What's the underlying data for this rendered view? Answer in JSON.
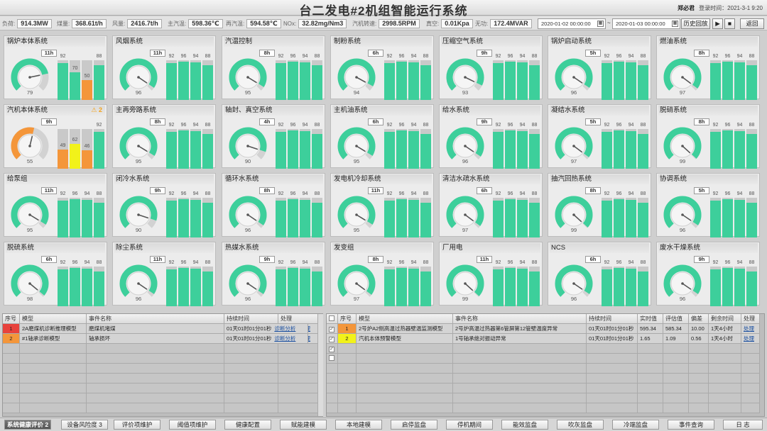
{
  "header": {
    "title": "台二发电#2机组智能运行系统",
    "user": "郑必君",
    "login_time": "登录时间：2021-3-1 9:20"
  },
  "metrics": [
    {
      "label": "负荷:",
      "value": "914.3MW"
    },
    {
      "label": "煤量:",
      "value": "368.61t/h"
    },
    {
      "label": "风量:",
      "value": "2416.7t/h"
    },
    {
      "label": "主汽温:",
      "value": "598.36℃"
    },
    {
      "label": "再汽温:",
      "value": "594.58℃"
    },
    {
      "label": "NOx:",
      "value": "32.82mg/Nm3"
    },
    {
      "label": "汽机转速:",
      "value": "2998.5RPM"
    },
    {
      "label": "真空:",
      "value": "0.01Kpa"
    },
    {
      "label": "无功:",
      "value": "172.4MVAR"
    }
  ],
  "history": {
    "start": "2020-01-02 00:00:00",
    "sep": "~",
    "end": "2020-01-03 00:00:00",
    "replay_label": "历史回放",
    "play_icon": "▶",
    "stop_icon": "■",
    "back_label": "返回"
  },
  "colors": {
    "ok": "#3dcf9b",
    "warn": "#f4963a",
    "alert": "#f2f21a",
    "track": "#c9c9c9"
  },
  "systems": [
    {
      "name": "锅炉本体系统",
      "hours": "11h",
      "score": 79,
      "status": "ok",
      "alarm": "",
      "bars": [
        92,
        70,
        50,
        88
      ],
      "bar_status": [
        "ok",
        "ok",
        "warn",
        "ok"
      ]
    },
    {
      "name": "风烟系统",
      "hours": "11h",
      "score": 96,
      "status": "ok",
      "alarm": "",
      "bars": [
        92,
        96,
        94,
        88
      ],
      "bar_status": [
        "ok",
        "ok",
        "ok",
        "ok"
      ]
    },
    {
      "name": "汽温控制",
      "hours": "8h",
      "score": 95,
      "status": "ok",
      "alarm": "",
      "bars": [
        92,
        96,
        94,
        88
      ],
      "bar_status": [
        "ok",
        "ok",
        "ok",
        "ok"
      ]
    },
    {
      "name": "制粉系统",
      "hours": "6h",
      "score": 94,
      "status": "ok",
      "alarm": "",
      "bars": [
        92,
        96,
        94,
        88
      ],
      "bar_status": [
        "ok",
        "ok",
        "ok",
        "ok"
      ]
    },
    {
      "name": "压缩空气系统",
      "hours": "9h",
      "score": 93,
      "status": "ok",
      "alarm": "",
      "bars": [
        92,
        96,
        94,
        88
      ],
      "bar_status": [
        "ok",
        "ok",
        "ok",
        "ok"
      ]
    },
    {
      "name": "锅炉启动系统",
      "hours": "5h",
      "score": 96,
      "status": "ok",
      "alarm": "",
      "bars": [
        92,
        96,
        94,
        88
      ],
      "bar_status": [
        "ok",
        "ok",
        "ok",
        "ok"
      ]
    },
    {
      "name": "燃油系统",
      "hours": "8h",
      "score": 97,
      "status": "ok",
      "alarm": "",
      "bars": [
        92,
        96,
        94,
        88
      ],
      "bar_status": [
        "ok",
        "ok",
        "ok",
        "ok"
      ]
    },
    {
      "name": "汽机本体系统",
      "hours": "9h",
      "score": 55,
      "status": "warn",
      "alarm": "⚠ 2",
      "bars": [
        49,
        62,
        46,
        92
      ],
      "bar_status": [
        "warn",
        "alert",
        "warn",
        "ok"
      ]
    },
    {
      "name": "主再旁路系统",
      "hours": "8h",
      "score": 95,
      "status": "ok",
      "alarm": "",
      "bars": [
        92,
        96,
        94,
        88
      ],
      "bar_status": [
        "ok",
        "ok",
        "ok",
        "ok"
      ]
    },
    {
      "name": "轴封、真空系统",
      "hours": "4h",
      "score": 90,
      "status": "ok",
      "alarm": "",
      "bars": [
        92,
        96,
        94,
        88
      ],
      "bar_status": [
        "ok",
        "ok",
        "ok",
        "ok"
      ]
    },
    {
      "name": "主机油系统",
      "hours": "6h",
      "score": 95,
      "status": "ok",
      "alarm": "",
      "bars": [
        92,
        96,
        94,
        88
      ],
      "bar_status": [
        "ok",
        "ok",
        "ok",
        "ok"
      ]
    },
    {
      "name": "给水系统",
      "hours": "9h",
      "score": 96,
      "status": "ok",
      "alarm": "",
      "bars": [
        92,
        96,
        94,
        88
      ],
      "bar_status": [
        "ok",
        "ok",
        "ok",
        "ok"
      ]
    },
    {
      "name": "凝结水系统",
      "hours": "5h",
      "score": 97,
      "status": "ok",
      "alarm": "",
      "bars": [
        92,
        96,
        94,
        88
      ],
      "bar_status": [
        "ok",
        "ok",
        "ok",
        "ok"
      ]
    },
    {
      "name": "脱硝系统",
      "hours": "8h",
      "score": 99,
      "status": "ok",
      "alarm": "",
      "bars": [
        92,
        96,
        94,
        88
      ],
      "bar_status": [
        "ok",
        "ok",
        "ok",
        "ok"
      ]
    },
    {
      "name": "给泵组",
      "hours": "11h",
      "score": 95,
      "status": "ok",
      "alarm": "",
      "bars": [
        92,
        96,
        94,
        88
      ],
      "bar_status": [
        "ok",
        "ok",
        "ok",
        "ok"
      ]
    },
    {
      "name": "闭冷水系统",
      "hours": "9h",
      "score": 90,
      "status": "ok",
      "alarm": "",
      "bars": [
        92,
        96,
        94,
        88
      ],
      "bar_status": [
        "ok",
        "ok",
        "ok",
        "ok"
      ]
    },
    {
      "name": "循环水系统",
      "hours": "8h",
      "score": 96,
      "status": "ok",
      "alarm": "",
      "bars": [
        92,
        96,
        94,
        88
      ],
      "bar_status": [
        "ok",
        "ok",
        "ok",
        "ok"
      ]
    },
    {
      "name": "发电机冷却系统",
      "hours": "11h",
      "score": 95,
      "status": "ok",
      "alarm": "",
      "bars": [
        92,
        96,
        94,
        88
      ],
      "bar_status": [
        "ok",
        "ok",
        "ok",
        "ok"
      ]
    },
    {
      "name": "清洁水疏水系统",
      "hours": "6h",
      "score": 97,
      "status": "ok",
      "alarm": "",
      "bars": [
        92,
        96,
        94,
        88
      ],
      "bar_status": [
        "ok",
        "ok",
        "ok",
        "ok"
      ]
    },
    {
      "name": "抽汽回热系统",
      "hours": "8h",
      "score": 99,
      "status": "ok",
      "alarm": "",
      "bars": [
        92,
        96,
        94,
        88
      ],
      "bar_status": [
        "ok",
        "ok",
        "ok",
        "ok"
      ]
    },
    {
      "name": "协调系统",
      "hours": "5h",
      "score": 96,
      "status": "ok",
      "alarm": "",
      "bars": [
        92,
        96,
        94,
        88
      ],
      "bar_status": [
        "ok",
        "ok",
        "ok",
        "ok"
      ]
    },
    {
      "name": "脱硫系统",
      "hours": "6h",
      "score": 98,
      "status": "ok",
      "alarm": "",
      "bars": [
        92,
        96,
        94,
        88
      ],
      "bar_status": [
        "ok",
        "ok",
        "ok",
        "ok"
      ]
    },
    {
      "name": "除尘系统",
      "hours": "11h",
      "score": 96,
      "status": "ok",
      "alarm": "",
      "bars": [
        92,
        96,
        94,
        88
      ],
      "bar_status": [
        "ok",
        "ok",
        "ok",
        "ok"
      ]
    },
    {
      "name": "热媒水系统",
      "hours": "9h",
      "score": 96,
      "status": "ok",
      "alarm": "",
      "bars": [
        92,
        96,
        94,
        88
      ],
      "bar_status": [
        "ok",
        "ok",
        "ok",
        "ok"
      ]
    },
    {
      "name": "发变组",
      "hours": "8h",
      "score": 97,
      "status": "ok",
      "alarm": "",
      "bars": [
        92,
        96,
        94,
        88
      ],
      "bar_status": [
        "ok",
        "ok",
        "ok",
        "ok"
      ]
    },
    {
      "name": "厂用电",
      "hours": "11h",
      "score": 99,
      "status": "ok",
      "alarm": "",
      "bars": [
        92,
        96,
        94,
        88
      ],
      "bar_status": [
        "ok",
        "ok",
        "ok",
        "ok"
      ]
    },
    {
      "name": "NCS",
      "hours": "6h",
      "score": 96,
      "status": "ok",
      "alarm": "",
      "bars": [
        92,
        96,
        94,
        88
      ],
      "bar_status": [
        "ok",
        "ok",
        "ok",
        "ok"
      ]
    },
    {
      "name": "废水干燥系统",
      "hours": "9h",
      "score": 96,
      "status": "ok",
      "alarm": "",
      "bars": [
        92,
        96,
        94,
        88
      ],
      "bar_status": [
        "ok",
        "ok",
        "ok",
        "ok"
      ]
    }
  ],
  "left_table": {
    "headers": [
      "序号",
      "模型",
      "事件名称",
      "持续时间",
      "处理"
    ],
    "rows": [
      {
        "no": "1",
        "no_color": "#e8423c",
        "model": "2A磨煤机诊断推理模型",
        "event": "磨煤机堵煤",
        "duration": "01天01时01分01秒",
        "diag": "诊断分析",
        "action": "处理"
      },
      {
        "no": "2",
        "no_color": "#f4963a",
        "model": "#1轴承诊断模型",
        "event": "轴承损坏",
        "duration": "01天01时01分01秒",
        "diag": "诊断分析",
        "action": "处理"
      }
    ]
  },
  "right_table": {
    "headers": [
      "",
      "序号",
      "模型",
      "事件名称",
      "持续时间",
      "实时值",
      "评估值",
      "偏差",
      "剩余时间",
      "处理"
    ],
    "rows": [
      {
        "checked": "✓",
        "no": "1",
        "no_color": "#f4963a",
        "model": "2号炉A2侧高温过热器壁温监测模型",
        "event": "2号炉高温过热器第6管屏第12管壁温度异常",
        "duration": "01天01时01分01秒",
        "realtime": "595.34",
        "estimate": "585.34",
        "deviation": "10.00",
        "remaining": "1天4小时",
        "action": "处理"
      },
      {
        "checked": "✓",
        "no": "2",
        "no_color": "#f2f21a",
        "model": "汽机本体预警模型",
        "event": "1号轴承绝对振动异常",
        "duration": "01天01时01分01秒",
        "realtime": "1.65",
        "estimate": "1.09",
        "deviation": "0.56",
        "remaining": "1天4小时",
        "action": "处理"
      }
    ],
    "extra_checks": [
      "✓",
      ""
    ]
  },
  "footer": {
    "tabs": [
      "系统健康评价 2",
      "设备风险度 3",
      "评价项维护",
      "阈值项维护",
      "健康配置",
      "赋能建模",
      "本地建模",
      "启停监盘",
      "停机期间",
      "能效监盘",
      "吹灰监盘",
      "冷端监盘",
      "事件查询",
      "日 志"
    ]
  }
}
